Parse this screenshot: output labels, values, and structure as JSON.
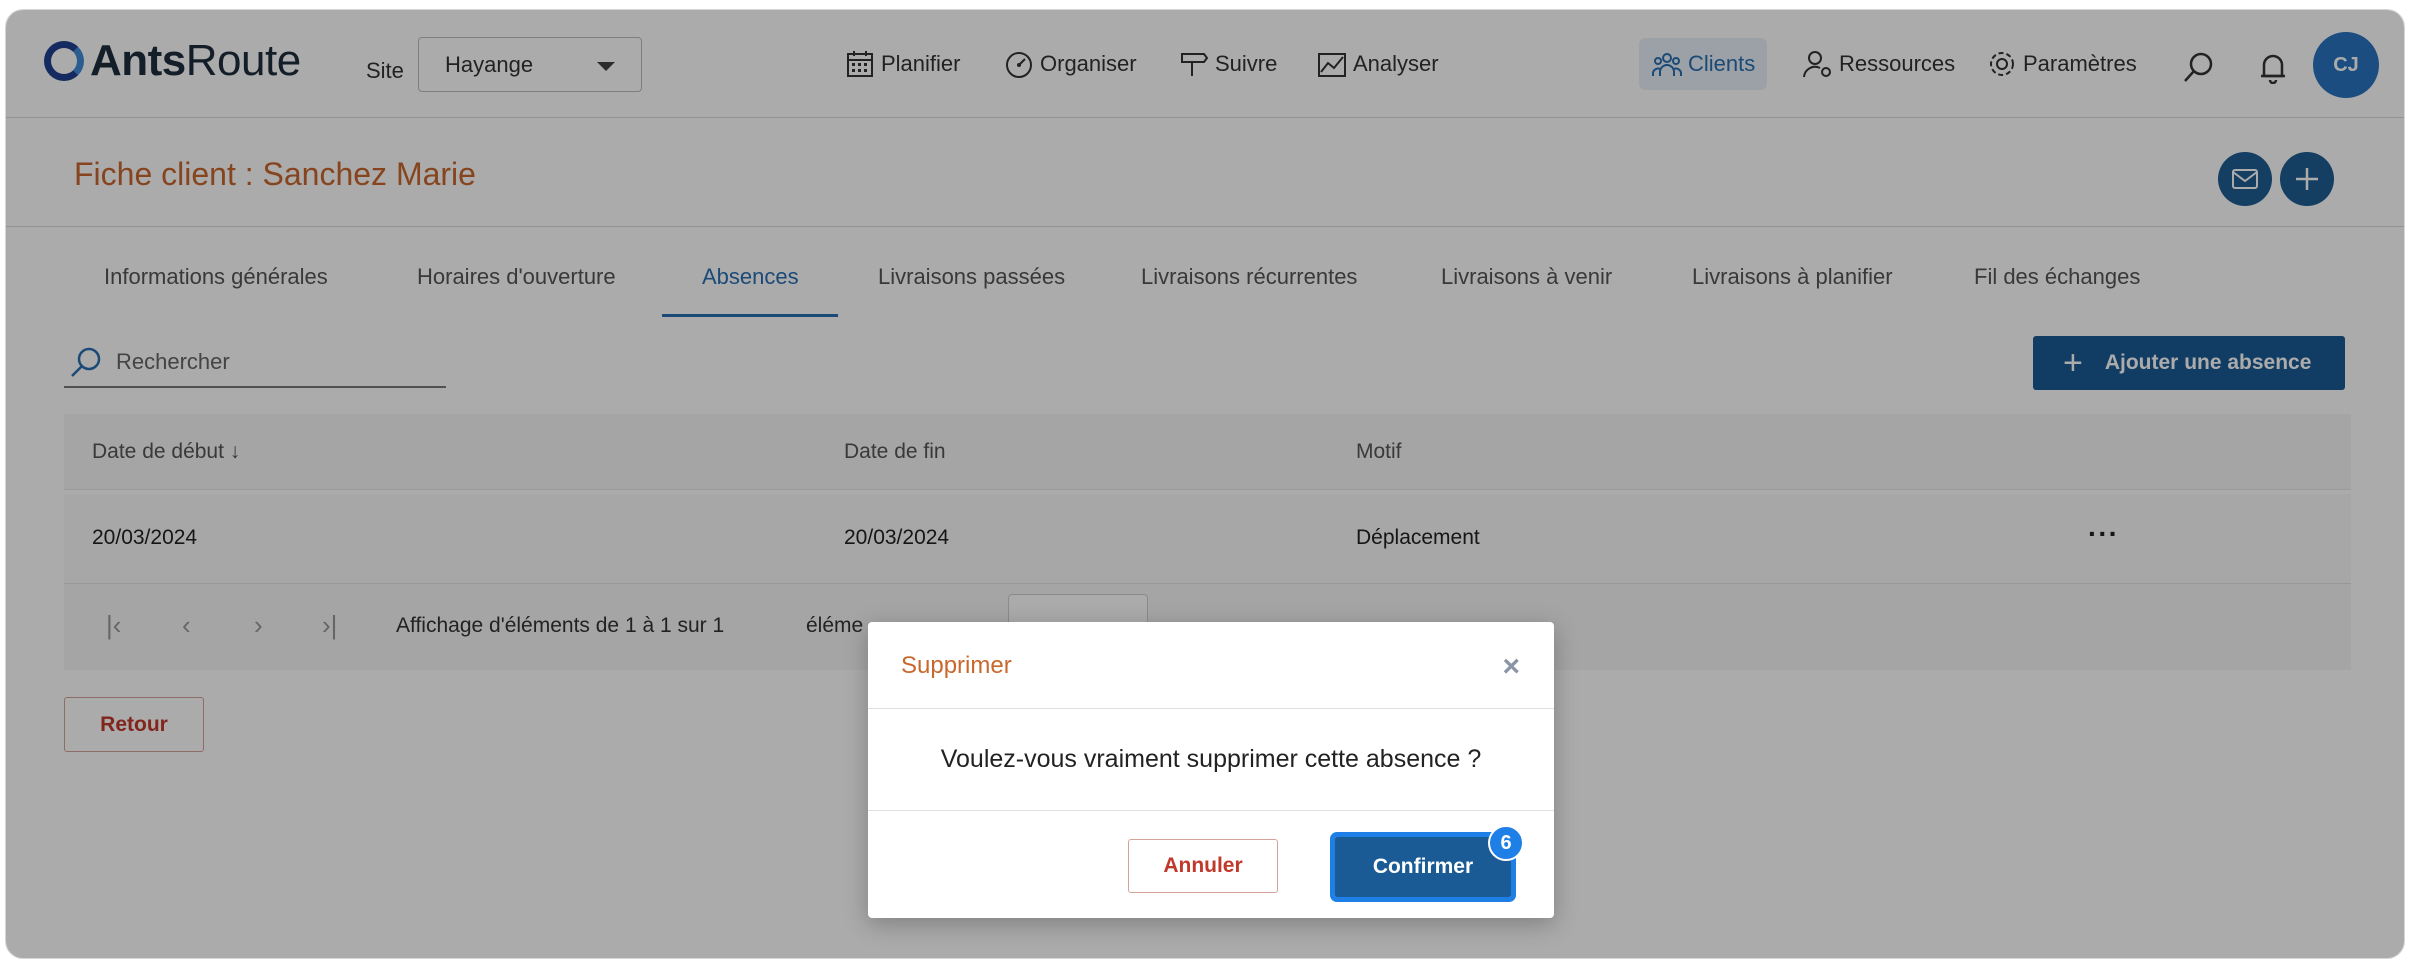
{
  "app": {
    "logo_bold": "Ants",
    "logo_light": "Route"
  },
  "site": {
    "label": "Site",
    "value": "Hayange"
  },
  "nav": {
    "planifier": "Planifier",
    "organiser": "Organiser",
    "suivre": "Suivre",
    "analyser": "Analyser",
    "clients": "Clients",
    "ressources": "Ressources",
    "parametres": "Paramètres"
  },
  "user": {
    "initials": "CJ"
  },
  "page": {
    "title": "Fiche client : Sanchez Marie"
  },
  "tabs": [
    {
      "label": "Informations générales"
    },
    {
      "label": "Horaires d'ouverture"
    },
    {
      "label": "Absences"
    },
    {
      "label": "Livraisons passées"
    },
    {
      "label": "Livraisons récurrentes"
    },
    {
      "label": "Livraisons à venir"
    },
    {
      "label": "Livraisons à planifier"
    },
    {
      "label": "Fil des échanges"
    }
  ],
  "search": {
    "placeholder": "Rechercher"
  },
  "add_button": {
    "label": "Ajouter une absence"
  },
  "table": {
    "headers": {
      "start": "Date de début",
      "end": "Date de fin",
      "reason": "Motif"
    },
    "rows": [
      {
        "start": "20/03/2024",
        "end": "20/03/2024",
        "reason": "Déplacement",
        "menu": "···"
      }
    ],
    "pager_text": "Affichage d'éléments de 1 à 1 sur 1",
    "pager_text2": "éléme"
  },
  "back_button": {
    "label": "Retour"
  },
  "modal": {
    "title": "Supprimer",
    "close": "×",
    "message": "Voulez-vous vraiment supprimer cette absence ?",
    "cancel": "Annuler",
    "confirm": "Confirmer",
    "step_badge": "6"
  },
  "colors": {
    "accent": "#2a6fb1",
    "primary_button": "#1a5a95",
    "title_orange": "#c8682d",
    "danger": "#c0392b",
    "highlight": "#1e7fe6"
  }
}
